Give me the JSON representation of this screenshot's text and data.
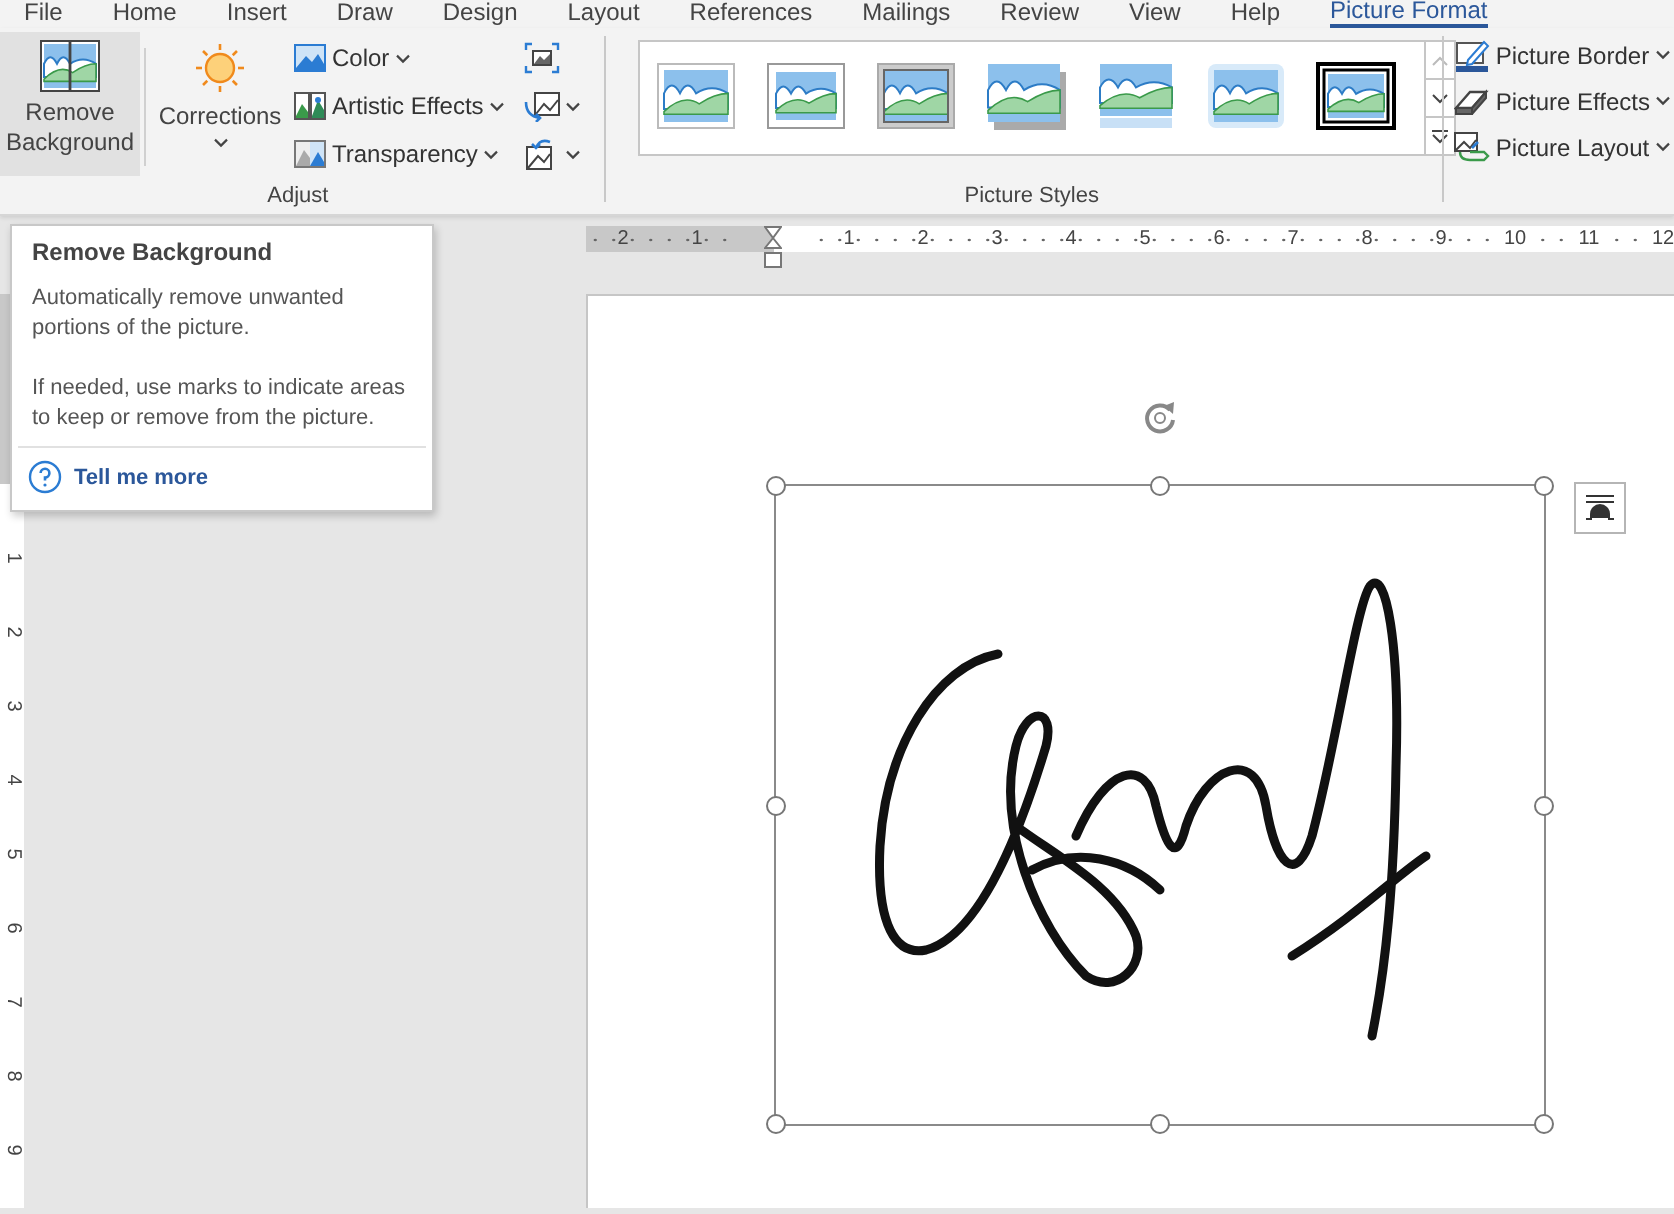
{
  "ribbon_tabs": [
    {
      "label": "File",
      "selected": false
    },
    {
      "label": "Home",
      "selected": false
    },
    {
      "label": "Insert",
      "selected": false
    },
    {
      "label": "Draw",
      "selected": false
    },
    {
      "label": "Design",
      "selected": false
    },
    {
      "label": "Layout",
      "selected": false
    },
    {
      "label": "References",
      "selected": false
    },
    {
      "label": "Mailings",
      "selected": false
    },
    {
      "label": "Review",
      "selected": false
    },
    {
      "label": "View",
      "selected": false
    },
    {
      "label": "Help",
      "selected": false
    },
    {
      "label": "Picture Format",
      "selected": true
    }
  ],
  "adjust_group": {
    "label": "Adjust",
    "remove_background": {
      "label": "Remove Background",
      "highlighted": true
    },
    "corrections": {
      "label": "Corrections"
    },
    "commands": [
      {
        "kind": "color",
        "label": "Color",
        "dropdown": true
      },
      {
        "kind": "artistic",
        "label": "Artistic Effects",
        "dropdown": true
      },
      {
        "kind": "transparency",
        "label": "Transparency",
        "dropdown": true
      }
    ],
    "icon_commands": [
      {
        "kind": "compress",
        "dropdown": false
      },
      {
        "kind": "change",
        "dropdown": true
      },
      {
        "kind": "reset",
        "dropdown": true
      }
    ]
  },
  "styles_group": {
    "label": "Picture Styles",
    "styles": [
      {
        "kind": "simple-frame"
      },
      {
        "kind": "white-frame"
      },
      {
        "kind": "gray-frame"
      },
      {
        "kind": "shadow"
      },
      {
        "kind": "reflection"
      },
      {
        "kind": "soft-edge"
      },
      {
        "kind": "black-frame"
      }
    ],
    "commands": [
      {
        "kind": "border",
        "label": "Picture Border",
        "dropdown": true
      },
      {
        "kind": "effects",
        "label": "Picture Effects",
        "dropdown": true
      },
      {
        "kind": "layout",
        "label": "Picture Layout",
        "dropdown": true
      }
    ]
  },
  "tooltip": {
    "title": "Remove Background",
    "paragraphs": [
      "Automatically remove unwanted portions of the picture.",
      "If needed, use marks to indicate areas to keep or remove from the picture."
    ],
    "link": "Tell me more"
  },
  "horizontal_ruler": [
    {
      "label": "2",
      "margin": true
    },
    {
      "label": "1",
      "margin": true
    },
    {
      "label": "1",
      "margin": false
    },
    {
      "label": "2",
      "margin": false
    },
    {
      "label": "3",
      "margin": false
    },
    {
      "label": "4",
      "margin": false
    },
    {
      "label": "5",
      "margin": false
    },
    {
      "label": "6",
      "margin": false
    },
    {
      "label": "7",
      "margin": false
    },
    {
      "label": "8",
      "margin": false
    },
    {
      "label": "9",
      "margin": false
    },
    {
      "label": "10",
      "margin": false
    },
    {
      "label": "11",
      "margin": false
    },
    {
      "label": "12",
      "margin": false
    }
  ],
  "vertical_ruler": [
    "1",
    "2",
    "3",
    "4",
    "5",
    "6",
    "7",
    "8",
    "9"
  ]
}
